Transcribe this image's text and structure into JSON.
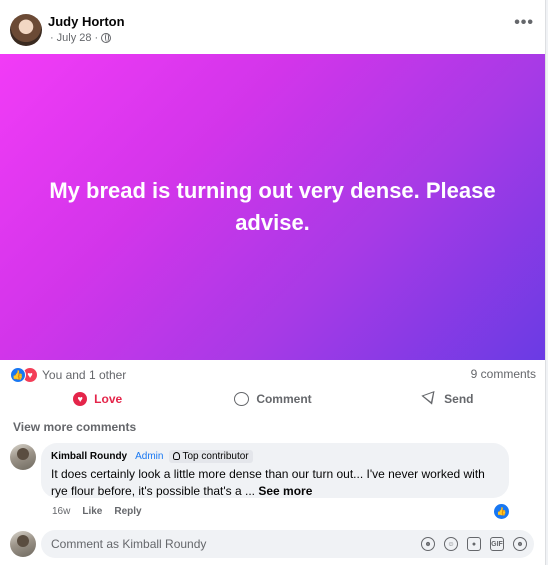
{
  "post": {
    "author": "Judy Horton",
    "date": "July 28",
    "meta_prefix": "·",
    "meta_suffix": "·",
    "more_glyph": "•••",
    "banner_text": "My bread is turning out very dense. Please advise.",
    "banner_colors": [
      "#f23bf7",
      "#6a3be4"
    ]
  },
  "reactions": {
    "summary": "You and 1 other",
    "comment_count": "9 comments",
    "icons": [
      "like-icon",
      "love-icon"
    ]
  },
  "actions": {
    "love_label": "Love",
    "comment_label": "Comment",
    "send_label": "Send",
    "love_color": "#e4254a"
  },
  "comments": {
    "view_more": "View more comments",
    "items": [
      {
        "author": "Kimball Roundy",
        "role": "Admin",
        "badge": "Top contributor",
        "text": "It does certainly look a little more dense than our turn out... I've never worked with rye flour before, it's possible that's a ... ",
        "see_more": "See more",
        "age": "16w",
        "like_label": "Like",
        "reply_label": "Reply"
      }
    ]
  },
  "composer": {
    "placeholder": "Comment as Kimball Roundy",
    "icons": [
      "avatar-sticker-icon",
      "emoji-icon",
      "camera-icon",
      "gif-icon",
      "sticker-icon"
    ],
    "gif_label": "GIF"
  }
}
